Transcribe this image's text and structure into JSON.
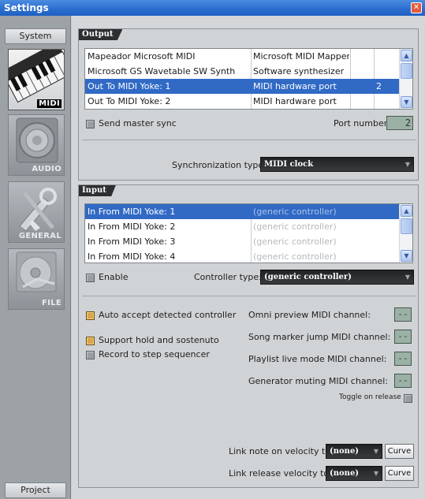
{
  "window": {
    "title": "Settings"
  },
  "sidebar": {
    "top_tab": "System",
    "bottom_tab": "Project",
    "items": [
      {
        "label": "MIDI",
        "icon": "midi-keyboard-icon",
        "active": true
      },
      {
        "label": "AUDIO",
        "icon": "speaker-icon",
        "active": false
      },
      {
        "label": "GENERAL",
        "icon": "tools-icon",
        "active": false
      },
      {
        "label": "FILE",
        "icon": "disc-icon",
        "active": false
      }
    ]
  },
  "output": {
    "title": "Output",
    "rows": [
      {
        "name": "Mapeador Microsoft MIDI",
        "type": "Microsoft MIDI Mapper",
        "port": ""
      },
      {
        "name": "Microsoft GS Wavetable SW Synth",
        "type": "Software synthesizer",
        "port": ""
      },
      {
        "name": "Out To MIDI Yoke:  1",
        "type": "MIDI hardware port",
        "port": "2",
        "selected": true
      },
      {
        "name": "Out To MIDI Yoke:  2",
        "type": "MIDI hardware port",
        "port": ""
      }
    ],
    "send_master_sync_label": "Send master sync",
    "port_number_label": "Port number:",
    "port_number_value": "2",
    "sync_type_label": "Synchronization type:",
    "sync_type_value": "MIDI clock"
  },
  "input": {
    "title": "Input",
    "rows": [
      {
        "name": "In From MIDI Yoke:  1",
        "controller": "(generic controller)",
        "selected": true
      },
      {
        "name": "In From MIDI Yoke:  2",
        "controller": "(generic controller)"
      },
      {
        "name": "In From MIDI Yoke:  3",
        "controller": "(generic controller)"
      },
      {
        "name": "In From MIDI Yoke:  4",
        "controller": "(generic controller)"
      }
    ],
    "enable_label": "Enable",
    "controller_type_label": "Controller type:",
    "controller_type_value": "(generic controller)",
    "auto_accept_label": "Auto accept detected controller",
    "support_hold_label": "Support hold and sostenuto",
    "record_step_label": "Record to step sequencer",
    "omni_label": "Omni preview MIDI channel:",
    "song_marker_label": "Song marker jump MIDI channel:",
    "playlist_label": "Playlist live mode MIDI channel:",
    "generator_label": "Generator muting MIDI channel:",
    "channel_value": "--",
    "toggle_release_label": "Toggle on release",
    "link_note_label": "Link note on velocity to:",
    "link_release_label": "Link release velocity to:",
    "link_value": "(none)",
    "curve_label": "Curve"
  },
  "colors": {
    "title_bar": "#2d6fd0",
    "selection": "#316ac5",
    "checkbox_on": "#d9a547",
    "lcd": "#9bb1a6"
  }
}
